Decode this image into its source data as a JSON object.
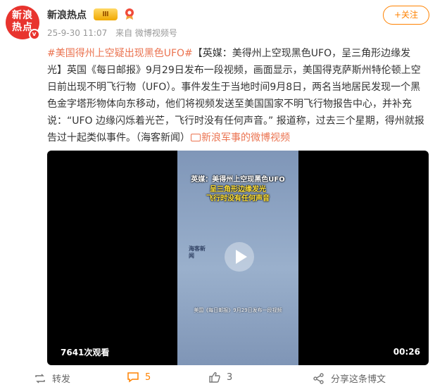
{
  "header": {
    "avatar_lines": [
      "新浪",
      "热点"
    ],
    "avatar_badge": "v",
    "name": "新浪热点",
    "vip_badge": "Ⅲ",
    "date": "25-9-30 11:07",
    "source": "来自 微博视频号",
    "follow_label": "+关注"
  },
  "post": {
    "hashtag": "#美国得州上空疑出现黑色UFO#",
    "text": "【英媒：美得州上空现黑色UFO，呈三角形边缘发光】英国《每日邮报》9月29日发布一段视频，画面显示，美国得克萨斯州特伦顿上空日前出现不明飞行物（UFO）。事件发生于当地时间9月8日，两名当地居民发现一个黑色金字塔形物体向东移动，他们将视频发送至美国国家不明飞行物报告中心，并补充说：“UFO 边缘闪烁着光芒，飞行时没有任何声音。” 报道称，过去三个星期，得州就报告过十起类似事件。（海客新闻）",
    "link_text": "新浪军事的微博视频"
  },
  "video": {
    "caption_line1": "英媒：美得州上空现黑色UFO",
    "caption_line2": "呈三角形边缘发光",
    "caption_line3": "飞行时没有任何声音",
    "caption_bottom": "美国《每日邮报》9月29日发布一段视频",
    "watermark": "海客新闻",
    "views": "7641次观看",
    "duration": "00:26"
  },
  "actions": {
    "repost_label": "转发",
    "comment_count": "5",
    "like_count": "3",
    "share_label": "分享这条博文"
  },
  "colors": {
    "accent_orange": "#ff8200",
    "link_color": "#eb7350",
    "avatar_red": "#e8342e"
  }
}
